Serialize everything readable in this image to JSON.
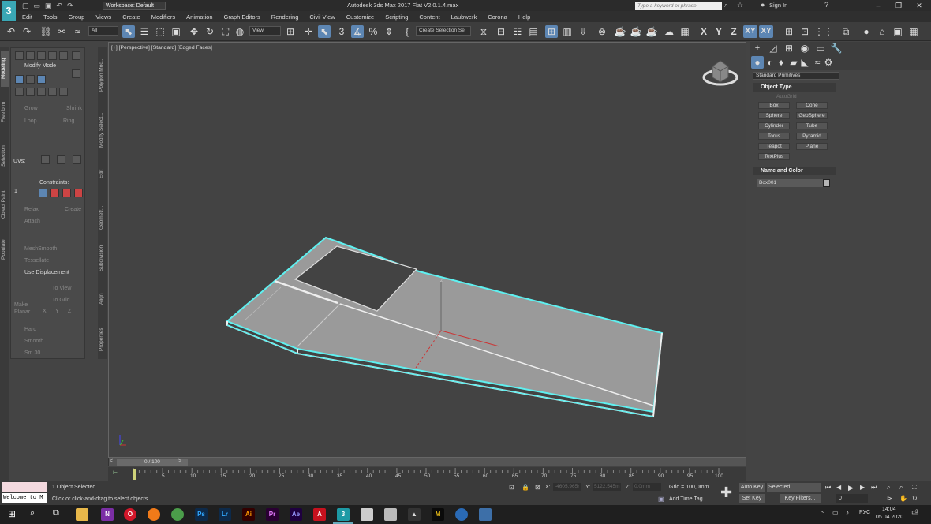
{
  "window": {
    "title": "Autodesk 3ds Max 2017      Flat V2.0.1.4.max",
    "workspace": "Workspace: Default",
    "search_placeholder": "Type a keyword or phrase",
    "sign_in": "Sign In",
    "logo_text": "3"
  },
  "menu": [
    "Edit",
    "Tools",
    "Group",
    "Views",
    "Create",
    "Modifiers",
    "Animation",
    "Graph Editors",
    "Rendering",
    "Civil View",
    "Customize",
    "Scripting",
    "Content",
    "Laubwerk",
    "Corona",
    "Help"
  ],
  "toolbar": {
    "selection_filter": "All",
    "reference_coord": "View",
    "selection_set": "Create Selection Se",
    "axis_x": "X",
    "axis_y": "Y",
    "axis_z": "Z",
    "axis_xy": "XY",
    "axis_xy2": "XY"
  },
  "ribbon": {
    "vertical_tabs": [
      "Modeling",
      "Freeform",
      "Selection",
      "Object Paint",
      "Populate"
    ],
    "panel_tabs": [
      "Polygon Mod...",
      "Modify Select...",
      "Edit",
      "Geometr...",
      "Subdivision",
      "Align",
      "Properties"
    ],
    "modify_mode": "Modify Mode",
    "grow": "Grow",
    "shrink": "Shrink",
    "loop": "Loop",
    "ring": "Ring",
    "uvs": "UVs:",
    "constraints": "Constraints:",
    "spinner_value": "1",
    "relax": "Relax",
    "create": "Create",
    "attach": "Attach",
    "meshsmooth": "MeshSmooth",
    "tessellate": "Tessellate",
    "use_displacement": "Use Displacement",
    "to_view": "To View",
    "to_grid": "To Grid",
    "make_planar": "Make Planar",
    "x": "X",
    "y": "Y",
    "z": "Z",
    "hard": "Hard",
    "smooth": "Smooth",
    "sm30": "Sm 30"
  },
  "viewport": {
    "label": "[+] [Perspective] [Standard] [Edged Faces]",
    "gizmo_label": "z"
  },
  "timeline": {
    "slider": "0 / 100",
    "ticks": [
      "5",
      "10",
      "15",
      "20",
      "25",
      "30",
      "35",
      "40",
      "45",
      "50",
      "55",
      "60",
      "65",
      "70",
      "75",
      "80",
      "85",
      "90",
      "95",
      "100"
    ]
  },
  "command_panel": {
    "category": "Standard Primitives",
    "object_type_title": "Object Type",
    "autogrid": "AutoGrid",
    "buttons": [
      "Box",
      "Cone",
      "Sphere",
      "GeoSphere",
      "Cylinder",
      "Tube",
      "Torus",
      "Pyramid",
      "Teapot",
      "Plane",
      "TextPlus"
    ],
    "name_color_title": "Name and Color",
    "object_name": "Box001",
    "object_color": "#b5b5b5"
  },
  "status": {
    "script_listener": "Welcome to M",
    "selected": "1 Object Selected",
    "prompt": "Click or click-and-drag to select objects",
    "x_label": "X:",
    "x_value": "-4605,965r",
    "y_label": "Y:",
    "y_value": "5122,545m",
    "z_label": "Z:",
    "z_value": "0,0mm",
    "grid": "Grid = 100,0mm",
    "add_time_tag": "Add Time Tag",
    "auto_key": "Auto Key",
    "set_key": "Set Key",
    "selected_dropdown": "Selected",
    "key_filters": "Key Filters...",
    "frame": "0"
  },
  "taskbar": {
    "lang": "РУС",
    "time": "14:04",
    "date": "05.04.2020",
    "notifications": "3",
    "apps": [
      "Ps",
      "Lr",
      "Ai",
      "Pr",
      "Ae",
      "A",
      "3",
      "M"
    ]
  }
}
